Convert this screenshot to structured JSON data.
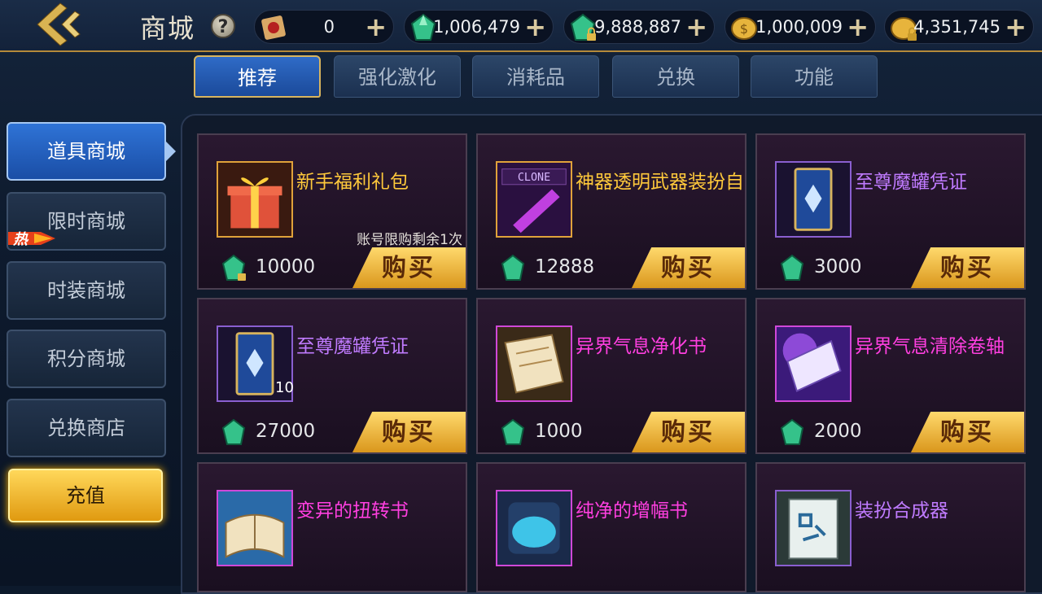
{
  "header": {
    "title": "商城",
    "help": "?",
    "currencies": [
      {
        "icon": "red-ticket-icon",
        "value": "0"
      },
      {
        "icon": "green-gem-icon",
        "value": "1,006,479"
      },
      {
        "icon": "locked-green-gem-icon",
        "value": "9,888,887"
      },
      {
        "icon": "gold-coin-icon",
        "value": "1,000,009"
      },
      {
        "icon": "locked-gold-coin-icon",
        "value": "4,351,745"
      }
    ],
    "plus": "+"
  },
  "tabs": [
    {
      "label": "推荐",
      "active": true
    },
    {
      "label": "强化激化",
      "active": false
    },
    {
      "label": "消耗品",
      "active": false
    },
    {
      "label": "兑换",
      "active": false
    },
    {
      "label": "功能",
      "active": false
    }
  ],
  "sidebar": {
    "items": [
      {
        "label": "道具商城",
        "active": true
      },
      {
        "label": "限时商城",
        "badge": "热"
      },
      {
        "label": "时装商城"
      },
      {
        "label": "积分商城"
      },
      {
        "label": "兑换商店"
      }
    ],
    "recharge": "充值"
  },
  "products": [
    {
      "name": "新手福利礼包",
      "color": "#ffc93b",
      "price": "10000",
      "note": "账号限购剩余1次",
      "locked_gem": true,
      "icon": "gift-box-icon"
    },
    {
      "name": "神器透明武器装扮自选",
      "color": "#ffc93b",
      "price": "12888",
      "icon": "clone-weapon-icon"
    },
    {
      "name": "至尊魔罐凭证",
      "color": "#c07bff",
      "price": "3000",
      "icon": "voucher-card-icon"
    },
    {
      "name": "至尊魔罐凭证",
      "color": "#c07bff",
      "price": "27000",
      "qty": "10",
      "icon": "voucher-card-icon"
    },
    {
      "name": "异界气息净化书",
      "color": "#ff3fe0",
      "price": "1000",
      "icon": "scroll-icon"
    },
    {
      "name": "异界气息清除卷轴",
      "color": "#ff3fe0",
      "price": "2000",
      "icon": "magic-scroll-icon"
    },
    {
      "name": "变异的扭转书",
      "color": "#ff3fe0",
      "price": "",
      "icon": "book-icon"
    },
    {
      "name": "纯净的增幅书",
      "color": "#ff3fe0",
      "price": "",
      "icon": "blue-orb-icon"
    },
    {
      "name": "装扮合成器",
      "color": "#c07bff",
      "price": "",
      "icon": "synthesizer-icon"
    }
  ],
  "buy_label": "购买"
}
